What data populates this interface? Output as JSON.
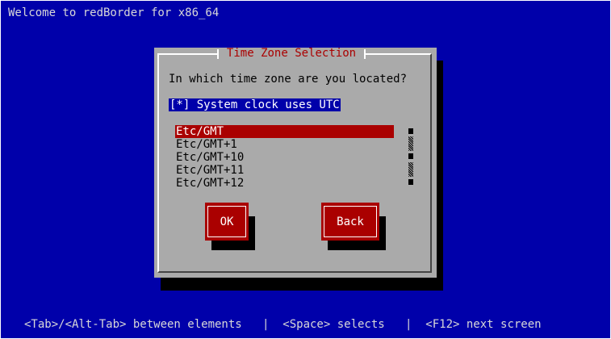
{
  "screen": {
    "header_title": "Welcome to redBorder for x86_64",
    "footer_help": "<Tab>/<Alt-Tab> between elements   |  <Space> selects   |  <F12> next screen"
  },
  "dialog": {
    "title": "Time Zone Selection",
    "question": "In which time zone are you located?",
    "checkbox_label": "[*] System clock uses UTC",
    "timezones": [
      "Etc/GMT",
      "Etc/GMT+1",
      "Etc/GMT+10",
      "Etc/GMT+11",
      "Etc/GMT+12"
    ],
    "selected_timezone": "Etc/GMT",
    "ok_label": "OK",
    "back_label": "Back"
  },
  "colors": {
    "background": "#0000aa",
    "dialog": "#aaaaaa",
    "accent": "#aa0000",
    "checkbox_highlight": "#0000aa"
  }
}
